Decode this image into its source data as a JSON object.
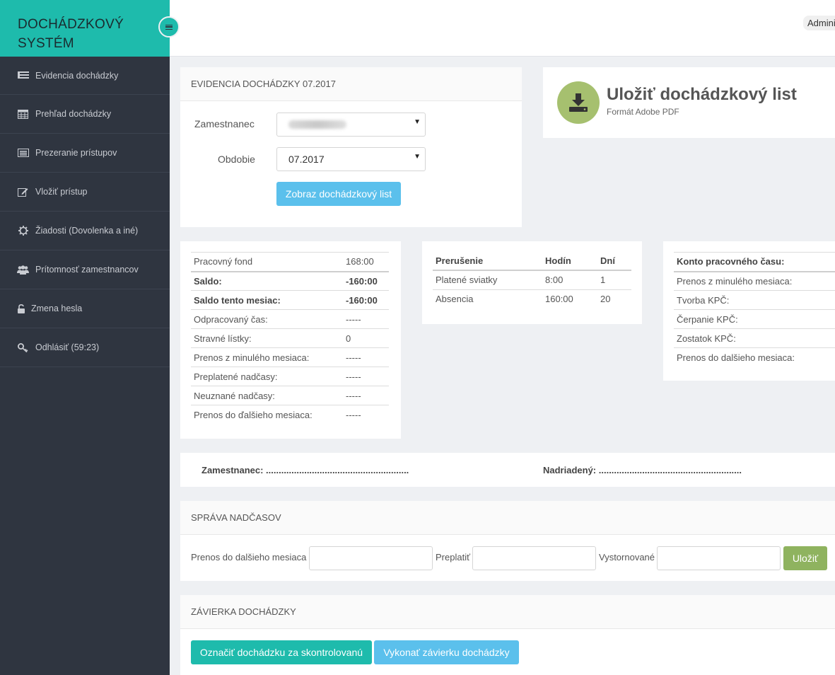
{
  "brand": {
    "line1": "DOCHÁDZKOVÝ",
    "line2": "SYSTÉM"
  },
  "topbar": {
    "user": "Administrator"
  },
  "sidebar": {
    "items": [
      {
        "label": "Evidencia dochádzky",
        "icon": "list-icon"
      },
      {
        "label": "Prehľad dochádzky",
        "icon": "calendar-icon"
      },
      {
        "label": "Prezeranie prístupov",
        "icon": "table-list-icon"
      },
      {
        "label": "Vložiť prístup",
        "icon": "edit-icon"
      },
      {
        "label": "Žiadosti (Dovolenka a iné)",
        "icon": "gear-icon"
      },
      {
        "label": "Prítomnosť zamestnancov",
        "icon": "users-icon"
      },
      {
        "label": "Zmena hesla",
        "icon": "unlock-icon"
      },
      {
        "label": "Odhlásiť (59:23)",
        "icon": "key-icon"
      }
    ]
  },
  "evidence": {
    "heading": "EVIDENCIA DOCHÁDZKY 07.2017",
    "employee_label": "Zamestnanec",
    "period_label": "Obdobie",
    "period_value": "07.2017",
    "show_button": "Zobraz dochádzkový list"
  },
  "download": {
    "title": "Uložiť dochádzkový list",
    "subtitle": "Formát Adobe PDF"
  },
  "summary": {
    "rows": [
      {
        "label": "Pracovný fond",
        "value": "168:00",
        "bold": false
      },
      {
        "label": "Saldo:",
        "value": "-160:00",
        "bold": true
      },
      {
        "label": "Saldo tento mesiac:",
        "value": "-160:00",
        "bold": true
      },
      {
        "label": "Odpracovaný čas:",
        "value": "-----",
        "bold": false
      },
      {
        "label": "Stravné lístky:",
        "value": "0",
        "bold": false
      },
      {
        "label": "Prenos z minulého mesiaca:",
        "value": "-----",
        "bold": false
      },
      {
        "label": "Preplatené nadčasy:",
        "value": "-----",
        "bold": false
      },
      {
        "label": "Neuznané nadčasy:",
        "value": "-----",
        "bold": false
      },
      {
        "label": "Prenos do ďalšieho mesiaca:",
        "value": "-----",
        "bold": false
      }
    ]
  },
  "interruptions": {
    "headers": [
      "Prerušenie",
      "Hodín",
      "Dní"
    ],
    "rows": [
      [
        "Platené sviatky",
        "8:00",
        "1"
      ],
      [
        "Absencia",
        "160:00",
        "20"
      ]
    ]
  },
  "account": {
    "header": "Konto pracovného času:",
    "rows": [
      "Prenos z minulého mesiaca:",
      "Tvorba KPČ:",
      "Čerpanie KPČ:",
      "Zostatok KPČ:",
      "Prenos do dalšieho mesiaca:"
    ]
  },
  "signatures": {
    "employee": "Zamestnanec: ........................................................",
    "supervisor": "Nadriadený: ........................................................"
  },
  "overtime": {
    "heading": "SPRÁVA NADČASOV",
    "transfer_label": "Prenos do dalšieho mesiaca",
    "payout_label": "Preplatiť",
    "cancel_label": "Vystornované",
    "save_button": "Uložiť"
  },
  "closing": {
    "heading": "ZÁVIERKA DOCHÁDZKY",
    "mark_button": "Označiť dochádzku za skontrolovanú",
    "close_button": "Vykonať závierku dochádzky"
  }
}
